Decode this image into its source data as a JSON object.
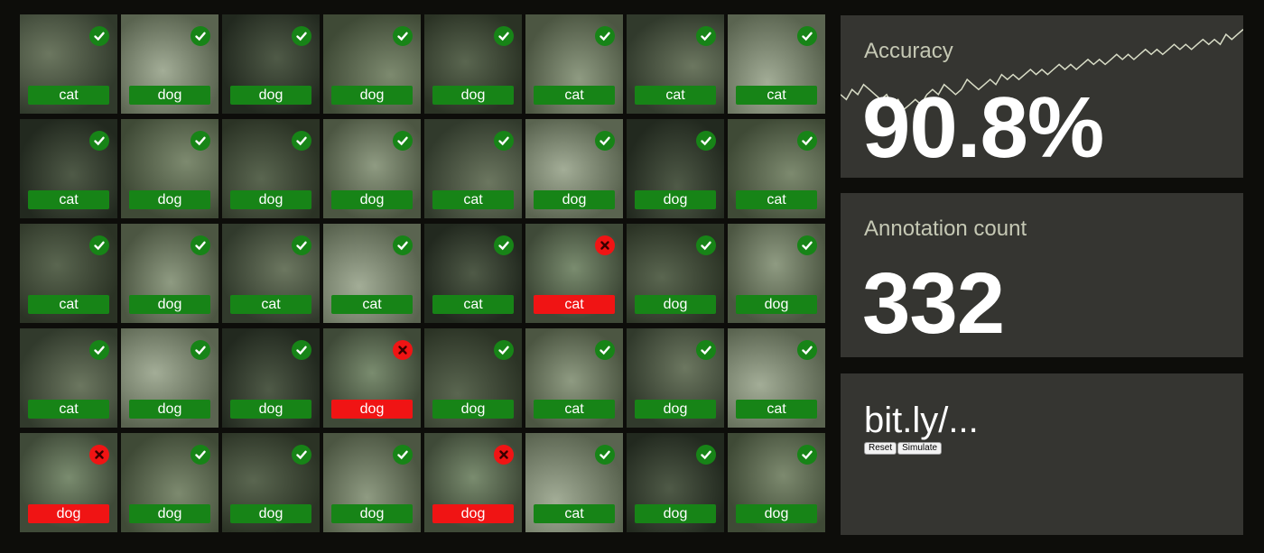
{
  "colors": {
    "correct": "#178417",
    "wrong": "#f01414",
    "panel_bg": "#353531",
    "page_bg": "#0d0d0a"
  },
  "tiles": [
    {
      "label": "cat",
      "correct": true
    },
    {
      "label": "dog",
      "correct": true
    },
    {
      "label": "dog",
      "correct": true
    },
    {
      "label": "dog",
      "correct": true
    },
    {
      "label": "dog",
      "correct": true
    },
    {
      "label": "cat",
      "correct": true
    },
    {
      "label": "cat",
      "correct": true
    },
    {
      "label": "cat",
      "correct": true
    },
    {
      "label": "cat",
      "correct": true
    },
    {
      "label": "dog",
      "correct": true
    },
    {
      "label": "dog",
      "correct": true
    },
    {
      "label": "dog",
      "correct": true
    },
    {
      "label": "cat",
      "correct": true
    },
    {
      "label": "dog",
      "correct": true
    },
    {
      "label": "dog",
      "correct": true
    },
    {
      "label": "cat",
      "correct": true
    },
    {
      "label": "cat",
      "correct": true
    },
    {
      "label": "dog",
      "correct": true
    },
    {
      "label": "cat",
      "correct": true
    },
    {
      "label": "cat",
      "correct": true
    },
    {
      "label": "cat",
      "correct": true
    },
    {
      "label": "cat",
      "correct": false
    },
    {
      "label": "dog",
      "correct": true
    },
    {
      "label": "dog",
      "correct": true
    },
    {
      "label": "cat",
      "correct": true
    },
    {
      "label": "dog",
      "correct": true
    },
    {
      "label": "dog",
      "correct": true
    },
    {
      "label": "dog",
      "correct": false
    },
    {
      "label": "dog",
      "correct": true
    },
    {
      "label": "cat",
      "correct": true
    },
    {
      "label": "dog",
      "correct": true
    },
    {
      "label": "cat",
      "correct": true
    },
    {
      "label": "dog",
      "correct": false
    },
    {
      "label": "dog",
      "correct": true
    },
    {
      "label": "dog",
      "correct": true
    },
    {
      "label": "dog",
      "correct": true
    },
    {
      "label": "dog",
      "correct": false
    },
    {
      "label": "cat",
      "correct": true
    },
    {
      "label": "dog",
      "correct": true
    },
    {
      "label": "dog",
      "correct": true
    }
  ],
  "accuracy": {
    "title": "Accuracy",
    "value": "90.8%",
    "trend": [
      0.82,
      0.81,
      0.83,
      0.82,
      0.84,
      0.83,
      0.82,
      0.81,
      0.82,
      0.8,
      0.81,
      0.79,
      0.8,
      0.81,
      0.8,
      0.82,
      0.83,
      0.82,
      0.84,
      0.83,
      0.82,
      0.83,
      0.85,
      0.84,
      0.83,
      0.84,
      0.85,
      0.84,
      0.86,
      0.85,
      0.86,
      0.85,
      0.86,
      0.87,
      0.86,
      0.87,
      0.86,
      0.87,
      0.88,
      0.87,
      0.88,
      0.87,
      0.88,
      0.89,
      0.88,
      0.89,
      0.88,
      0.89,
      0.9,
      0.89,
      0.9,
      0.89,
      0.9,
      0.91,
      0.9,
      0.91,
      0.9,
      0.91,
      0.92,
      0.91,
      0.92,
      0.91,
      0.92,
      0.93,
      0.92,
      0.93,
      0.92,
      0.94,
      0.93,
      0.94,
      0.95
    ]
  },
  "annotations": {
    "title": "Annotation count",
    "value": "332"
  },
  "link": {
    "text": "bit.ly/...",
    "reset_label": "Reset",
    "simulate_label": "Simulate"
  }
}
